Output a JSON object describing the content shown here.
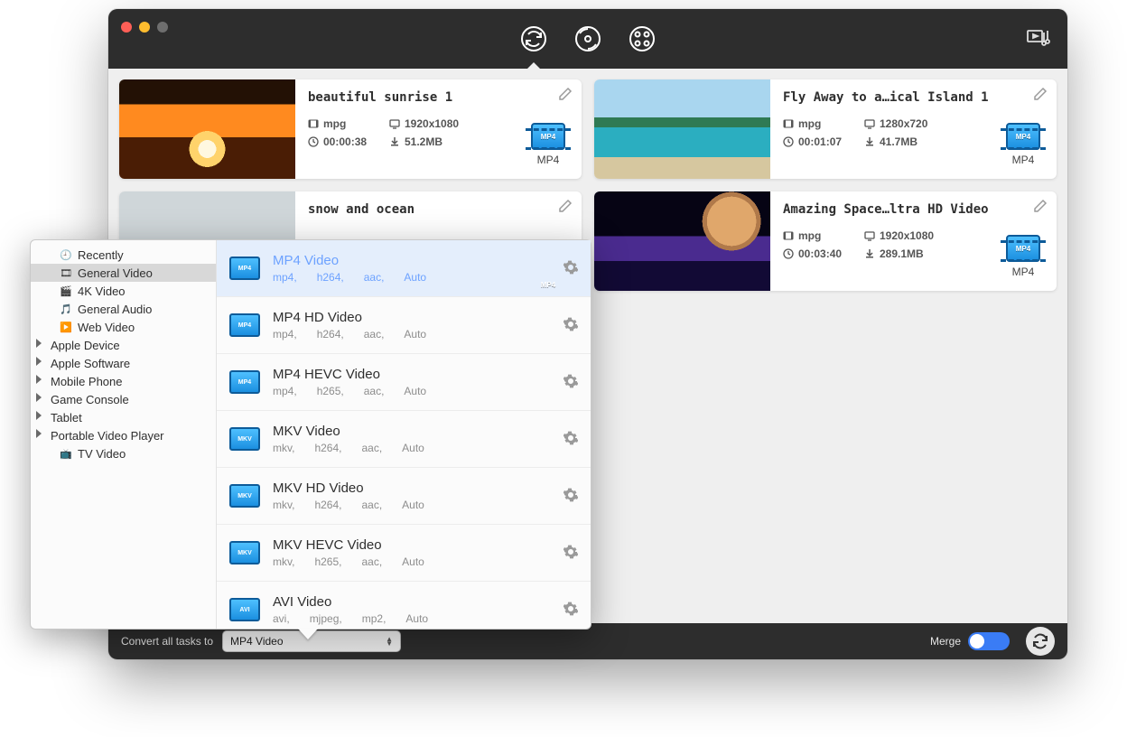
{
  "titlebar": {
    "modes": [
      "convert",
      "disc",
      "media"
    ],
    "active_mode": 0
  },
  "tasks": [
    {
      "title": "beautiful sunrise 1",
      "thumb": "sunrise",
      "format": "mpg",
      "resolution": "1920x1080",
      "duration": "00:00:38",
      "size": "51.2MB",
      "out_label": "MP4",
      "out_badge": "MP4"
    },
    {
      "title": "Fly Away to a…ical Island 1",
      "thumb": "beach",
      "format": "mpg",
      "resolution": "1280x720",
      "duration": "00:01:07",
      "size": "41.7MB",
      "out_label": "MP4",
      "out_badge": "MP4"
    },
    {
      "title": "snow and ocean",
      "thumb": "snow",
      "format": "",
      "resolution": "",
      "duration": "",
      "size": "",
      "out_label": "",
      "out_badge": "MP4",
      "partial": true
    },
    {
      "title": "Amazing Space…ltra HD Video",
      "thumb": "space",
      "format": "mpg",
      "resolution": "1920x1080",
      "duration": "00:03:40",
      "size": "289.1MB",
      "out_label": "MP4",
      "out_badge": "MP4"
    }
  ],
  "footer": {
    "convert_label": "Convert all tasks to",
    "combo_value": "MP4 Video",
    "merge_label": "Merge",
    "merge_on": true
  },
  "popup": {
    "categories": [
      {
        "label": "Recently",
        "leaf": true,
        "icon": "clock"
      },
      {
        "label": "General Video",
        "leaf": true,
        "icon": "video",
        "selected": true
      },
      {
        "label": "4K Video",
        "leaf": true,
        "icon": "4k"
      },
      {
        "label": "General Audio",
        "leaf": true,
        "icon": "audio"
      },
      {
        "label": "Web Video",
        "leaf": true,
        "icon": "web"
      },
      {
        "label": "Apple Device",
        "leaf": false
      },
      {
        "label": "Apple Software",
        "leaf": false
      },
      {
        "label": "Mobile Phone",
        "leaf": false
      },
      {
        "label": "Game Console",
        "leaf": false
      },
      {
        "label": "Tablet",
        "leaf": false
      },
      {
        "label": "Portable Video Player",
        "leaf": false
      },
      {
        "label": "TV Video",
        "leaf": true,
        "icon": "tv",
        "indent": true
      }
    ],
    "formats": [
      {
        "name": "MP4 Video",
        "badge": "MP4",
        "specs": [
          "mp4,",
          "h264,",
          "aac,",
          "Auto"
        ],
        "selected": true
      },
      {
        "name": "MP4 HD Video",
        "badge": "MP4",
        "specs": [
          "mp4,",
          "h264,",
          "aac,",
          "Auto"
        ]
      },
      {
        "name": "MP4 HEVC Video",
        "badge": "MP4",
        "specs": [
          "mp4,",
          "h265,",
          "aac,",
          "Auto"
        ]
      },
      {
        "name": "MKV Video",
        "badge": "MKV",
        "specs": [
          "mkv,",
          "h264,",
          "aac,",
          "Auto"
        ]
      },
      {
        "name": "MKV HD Video",
        "badge": "MKV",
        "specs": [
          "mkv,",
          "h264,",
          "aac,",
          "Auto"
        ]
      },
      {
        "name": "MKV HEVC Video",
        "badge": "MKV",
        "specs": [
          "mkv,",
          "h265,",
          "aac,",
          "Auto"
        ]
      },
      {
        "name": "AVI Video",
        "badge": "AVI",
        "specs": [
          "avi,",
          "mjpeg,",
          "mp2,",
          "Auto"
        ]
      }
    ]
  }
}
